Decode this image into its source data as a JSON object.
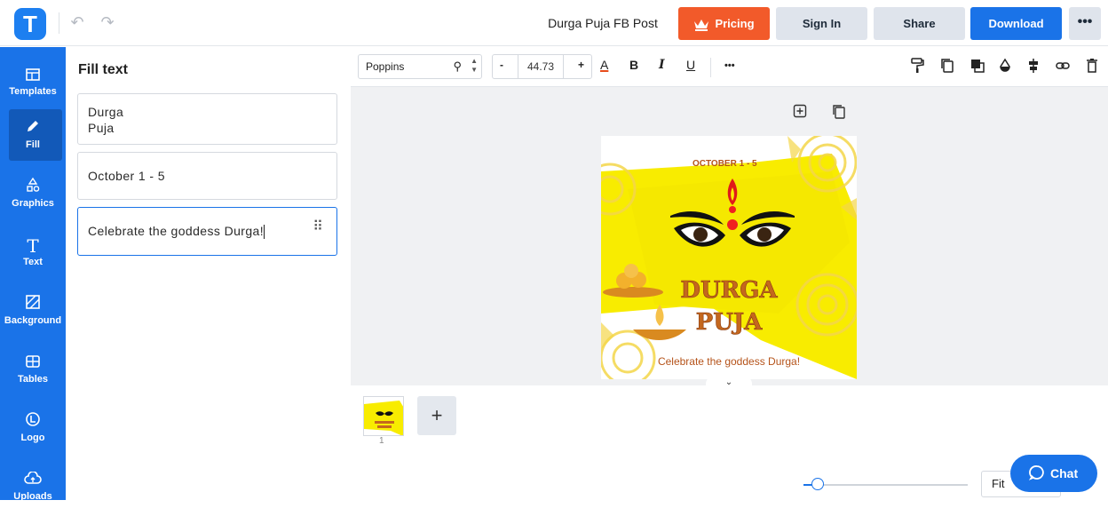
{
  "app": {
    "logo_letter": "T"
  },
  "header": {
    "doc_title": "Durga Puja FB Post",
    "pricing": "Pricing",
    "sign_in": "Sign In",
    "share": "Share",
    "download": "Download",
    "more": "•••"
  },
  "sidebar": {
    "items": [
      {
        "label": "Templates",
        "icon": "templates-icon"
      },
      {
        "label": "Fill",
        "icon": "pencil-icon"
      },
      {
        "label": "Graphics",
        "icon": "shapes-icon"
      },
      {
        "label": "Text",
        "icon": "text-icon"
      },
      {
        "label": "Background",
        "icon": "background-icon"
      },
      {
        "label": "Tables",
        "icon": "table-icon"
      },
      {
        "label": "Logo",
        "icon": "logo-icon"
      },
      {
        "label": "Uploads",
        "icon": "cloud-upload-icon"
      }
    ]
  },
  "panel": {
    "title": "Fill text",
    "fields": [
      {
        "line1": "Durga",
        "line2": "Puja"
      },
      {
        "value": "October 1 - 5"
      },
      {
        "value": "Celebrate the goddess Durga!"
      }
    ]
  },
  "toolbar": {
    "font": "Poppins",
    "size": "44.73",
    "minus": "-",
    "plus": "+",
    "color_a": "A",
    "bold": "B",
    "italic": "I",
    "underline": "U",
    "more": "•••"
  },
  "design": {
    "date": "OCTOBER 1 - 5",
    "title1": "DURGA",
    "title2": "PUJA",
    "subtitle": "Celebrate the goddess Durga!"
  },
  "pages": {
    "current": "1"
  },
  "zoom": {
    "fit": "Fit"
  },
  "chat": {
    "label": "Chat"
  },
  "colors": {
    "accent": "#1a73e8",
    "pricing": "#f25a2a",
    "design_yellow": "#f8ec00",
    "design_text": "#b5531a"
  }
}
